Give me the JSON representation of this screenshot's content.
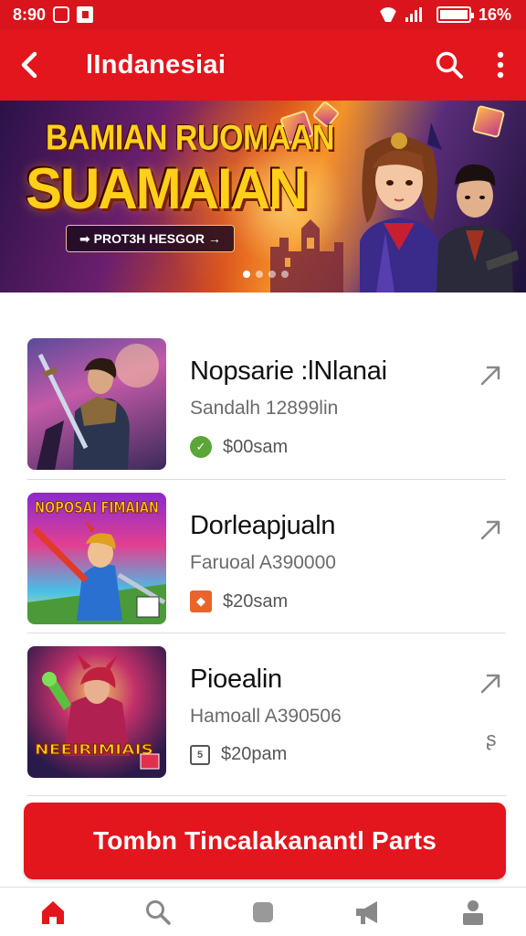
{
  "status_bar": {
    "time": "8:90",
    "battery": "16%"
  },
  "app_bar": {
    "title": "lIndanesiai"
  },
  "banner": {
    "title_line1": "BAMIAN RUOMAAN",
    "title_line2": "SUAMAIAN",
    "pill_text": "➡ PROT3H HESGOR →",
    "slides": 4,
    "active_slide": 0
  },
  "items": [
    {
      "title": "Nopsarie :lNlanai",
      "subtitle": "Sandalh 12899lin",
      "price": "$00sam",
      "price_icon": "check-badge-icon"
    },
    {
      "title": "Dorleapjualn",
      "subtitle": "Faruoal A390000",
      "price": "$20sam",
      "price_icon": "tag-icon",
      "thumb_text": "NOPOSAI FIMAIAN"
    },
    {
      "title": "Pioealin",
      "subtitle": "Hamoall A390506",
      "price": "$20pam",
      "price_icon": "box-icon",
      "thumb_text": "NEEIRIMIAIS"
    }
  ],
  "cta": {
    "label": "Tombn Tincalakanantl Parts"
  },
  "colors": {
    "primary": "#e3151d",
    "status": "#d9141c"
  },
  "bottom_nav": [
    "home-icon",
    "search-icon",
    "square-icon",
    "megaphone-icon",
    "profile-icon"
  ]
}
